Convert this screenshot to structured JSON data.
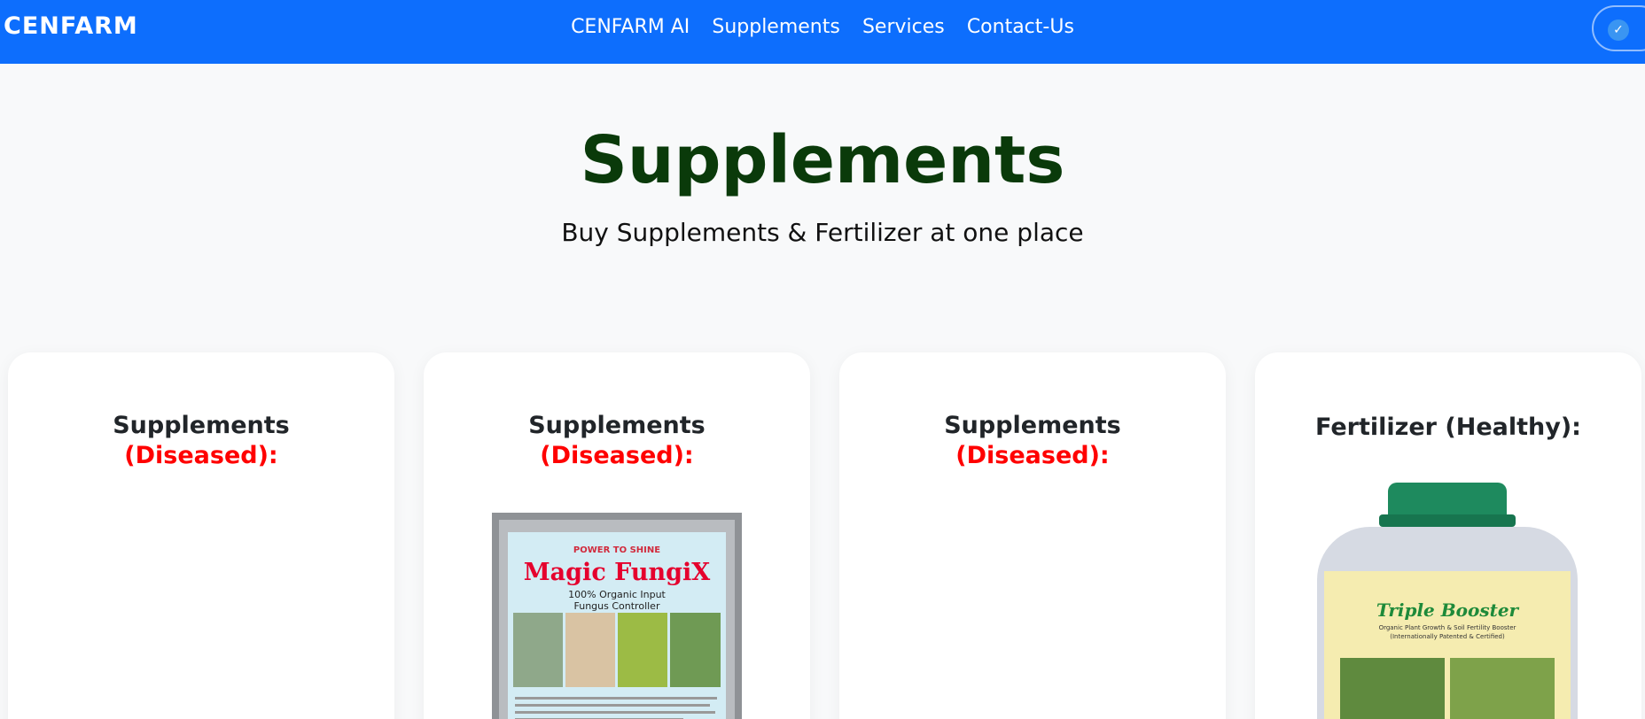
{
  "navbar": {
    "brand": "CENFARM",
    "links": [
      "CENFARM AI",
      "Supplements",
      "Services",
      "Contact-Us"
    ]
  },
  "hero": {
    "title": "Supplements",
    "subtitle": "Buy Supplements & Fertilizer at one place"
  },
  "cards": [
    {
      "title": "Supplements",
      "status": "(Diseased):"
    },
    {
      "title": "Supplements",
      "status": "(Diseased):"
    },
    {
      "title": "Supplements",
      "status": "(Diseased):"
    },
    {
      "title": "Fertilizer (Healthy):"
    }
  ],
  "products": {
    "fungix": {
      "tag": "POWER TO SHINE",
      "name": "Magic FungiX",
      "line1": "100% Organic Input",
      "line2": "Fungus Controller"
    },
    "booster": {
      "name": "Triple Booster",
      "line1": "Organic Plant Growth & Soil Fertility Booster",
      "line2": "(Internationally Patented & Certified)"
    }
  },
  "colors": {
    "navbar": "#0d6efd",
    "title": "#0a3a0a",
    "diseased": "#ff0000"
  }
}
